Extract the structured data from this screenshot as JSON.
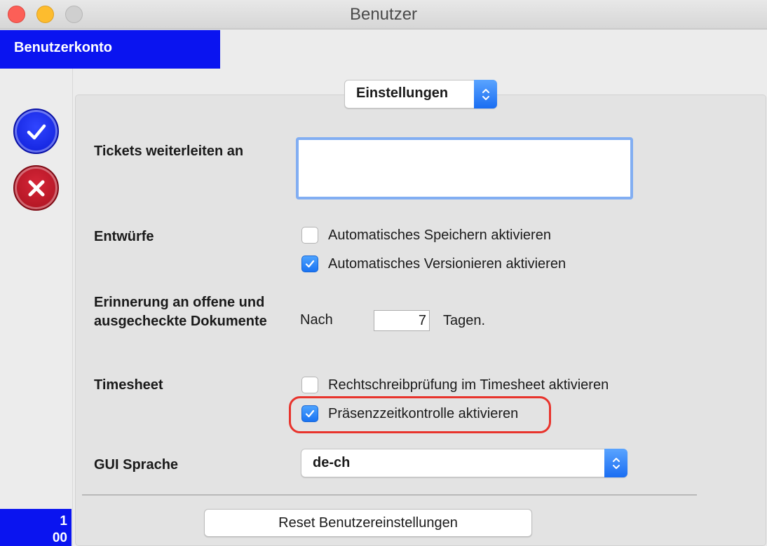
{
  "window": {
    "title": "Benutzer"
  },
  "tab": {
    "label": "Benutzerkonto"
  },
  "counter": {
    "line1": "1",
    "line2": "00"
  },
  "section_popup": {
    "label": "Einstellungen"
  },
  "forward": {
    "label": "Tickets weiterleiten an",
    "value": ""
  },
  "drafts": {
    "label": "Entwürfe",
    "autosave": {
      "label": "Automatisches Speichern aktivieren",
      "checked": false
    },
    "versioning": {
      "label": "Automatisches Versionieren aktivieren",
      "checked": true
    }
  },
  "reminder": {
    "label_line1": "Erinnerung an offene und",
    "label_line2": "ausgecheckte Dokumente",
    "prefix": "Nach",
    "days": "7",
    "suffix": "Tagen."
  },
  "timesheet": {
    "label": "Timesheet",
    "spellcheck": {
      "label": "Rechtschreibprüfung im Timesheet aktivieren",
      "checked": false
    },
    "presence": {
      "label": "Präsenzzeitkontrolle aktivieren",
      "checked": true
    }
  },
  "language": {
    "label": "GUI Sprache",
    "value": "de-ch"
  },
  "reset_button": {
    "label": "Reset Benutzereinstellungen"
  },
  "colors": {
    "accent_blue": "#0a14f0",
    "cancel_red": "#b3121f",
    "highlight_red": "#e8332c"
  }
}
